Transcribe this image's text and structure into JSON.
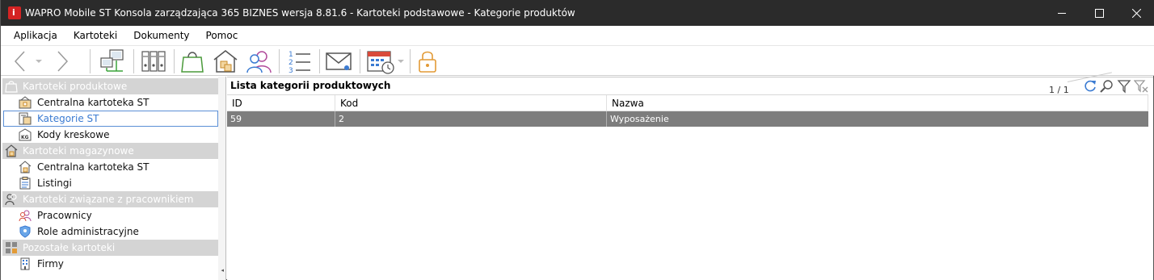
{
  "window": {
    "title": "WAPRO Mobile ST Konsola zarządzająca 365 BIZNES wersja 8.81.6 - Kartoteki podstawowe - Kategorie produktów"
  },
  "menu": {
    "items": [
      "Aplikacja",
      "Kartoteki",
      "Dokumenty",
      "Pomoc"
    ]
  },
  "toolbar": {
    "buttons": [
      {
        "icon": "back-arrow-icon"
      },
      {
        "icon": "dropdown-arrow-icon"
      },
      {
        "icon": "forward-arrow-icon"
      },
      {
        "icon": "network-icon"
      },
      {
        "icon": "binders-icon"
      },
      {
        "icon": "shopping-bag-icon"
      },
      {
        "icon": "warehouse-icon"
      },
      {
        "icon": "users-icon"
      },
      {
        "icon": "numbered-list-icon"
      },
      {
        "icon": "mail-icon"
      },
      {
        "icon": "calendar-clock-icon"
      },
      {
        "icon": "lock-icon"
      }
    ]
  },
  "sidebar": {
    "groups": [
      {
        "label": "Kartoteki produktowe",
        "icon": "bag-icon",
        "items": [
          {
            "label": "Centralna kartoteka ST",
            "icon": "product-box-icon"
          },
          {
            "label": "Kategorie ST",
            "icon": "category-icon",
            "selected": true
          },
          {
            "label": "Kody kreskowe",
            "icon": "barcode-kg-icon"
          }
        ]
      },
      {
        "label": "Kartoteki magazynowe",
        "icon": "warehouse-icon",
        "items": [
          {
            "label": "Centralna kartoteka ST",
            "icon": "warehouse-box-icon"
          },
          {
            "label": "Listingi",
            "icon": "clipboard-icon"
          }
        ]
      },
      {
        "label": "Kartoteki związane z pracownikiem",
        "icon": "person-icon",
        "items": [
          {
            "label": "Pracownicy",
            "icon": "employees-icon"
          },
          {
            "label": "Role administracyjne",
            "icon": "shield-icon"
          }
        ]
      },
      {
        "label": "Pozostałe kartoteki",
        "icon": "tiles-icon",
        "items": [
          {
            "label": "Firmy",
            "icon": "building-icon"
          }
        ]
      }
    ]
  },
  "list": {
    "title": "Lista kategorii produktowych",
    "pager": "1 / 1",
    "columns": [
      "ID",
      "Kod",
      "Nazwa"
    ],
    "rows": [
      {
        "id": "59",
        "kod": "2",
        "nazwa": "Wyposażenie"
      }
    ]
  },
  "colors": {
    "titlebar": "#2b2b2b",
    "group_header": "#d4d4d4",
    "selected_row": "#7d7d7d",
    "selected_item": "#3b7bd2"
  }
}
